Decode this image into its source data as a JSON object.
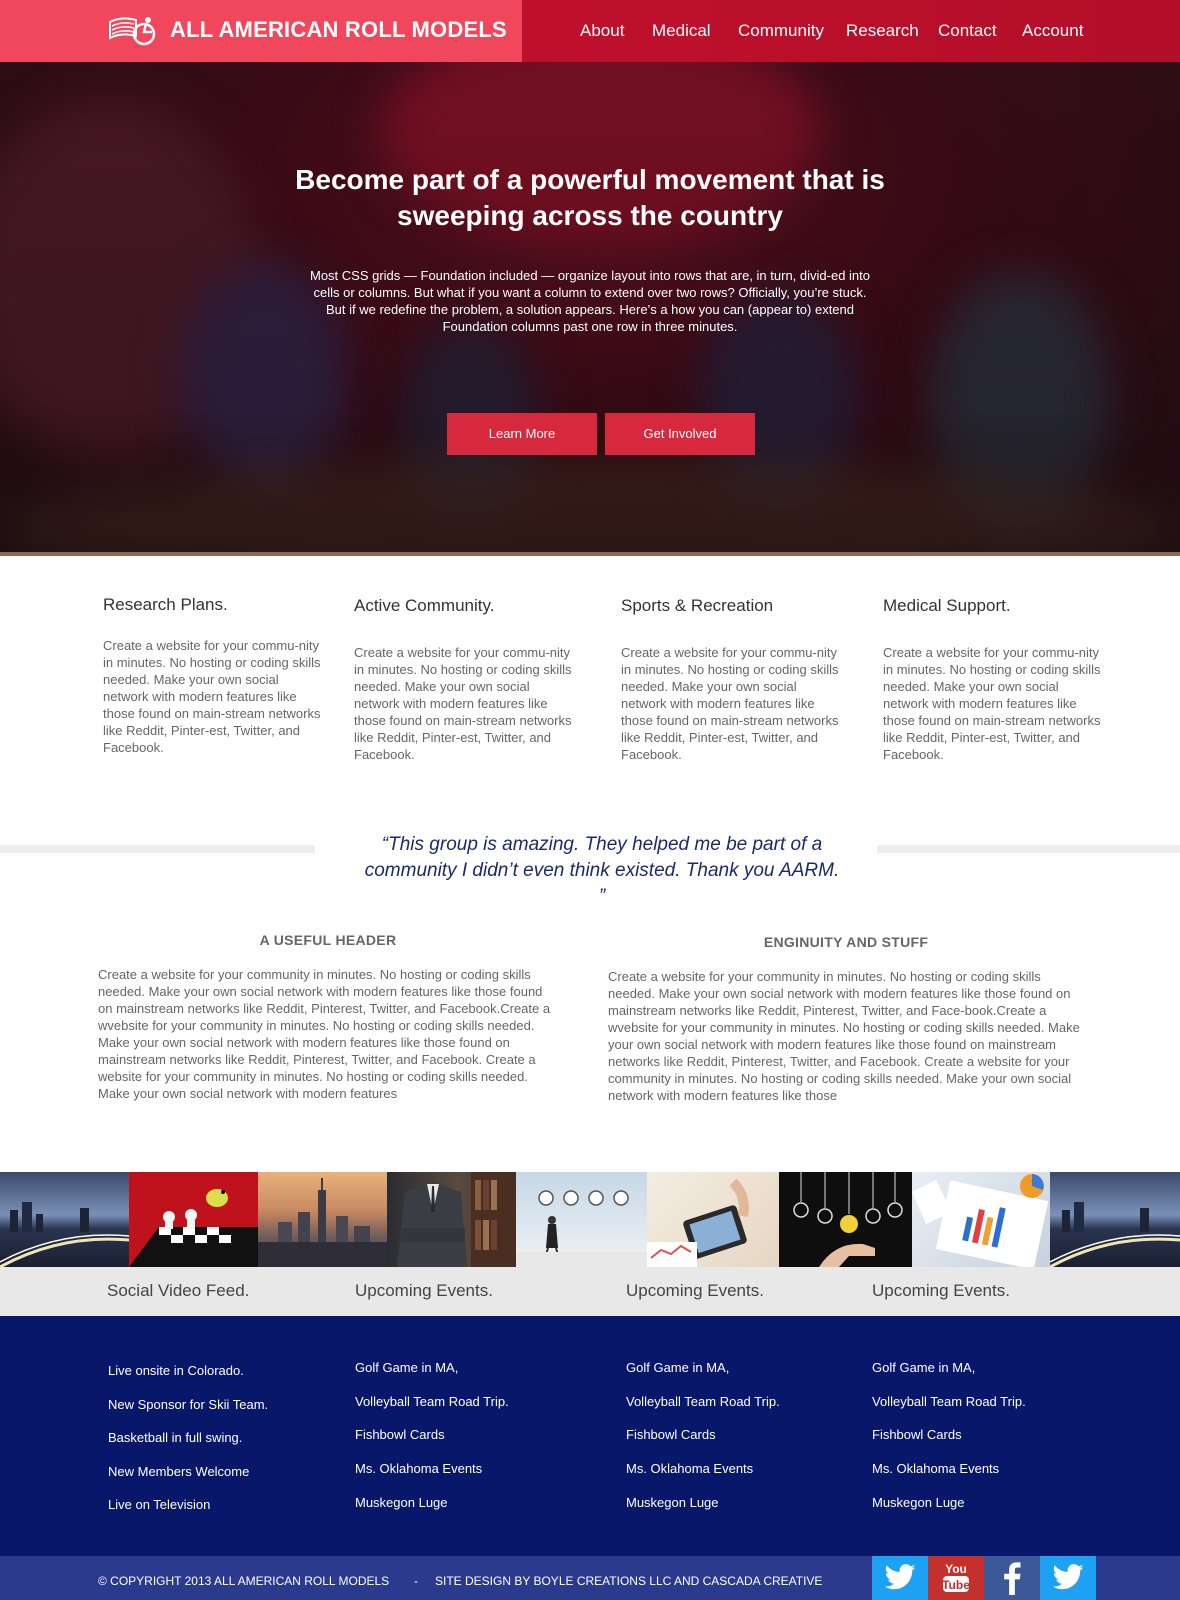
{
  "header": {
    "brand": "ALL AMERICAN ROLL MODELS",
    "nav": [
      "About",
      "Medical",
      "Community",
      "Research",
      "Contact",
      "Account"
    ]
  },
  "hero": {
    "title": "Become part of a powerful movement that is sweeping across the country",
    "text": "Most CSS grids — Foundation included — organize layout into rows that are, in turn, divid-ed into cells or columns. But what if you want a column to extend over two rows? Officially, you’re stuck. But if we redefine the problem, a solution appears. Here’s a how you can (appear to) extend Foundation columns past one row in three minutes.",
    "buttons": [
      "Learn More",
      "Get Involved"
    ]
  },
  "features": [
    {
      "title": "Research Plans.",
      "text": "Create a website for your commu-nity in minutes. No hosting or coding skills needed. Make your own social network with modern features like those found on main-stream networks like Reddit, Pinter-est, Twitter, and Facebook."
    },
    {
      "title": "Active Community.",
      "text": "Create a website for your commu-nity in minutes. No hosting or coding skills needed. Make your own social network with modern features like those found on main-stream networks like Reddit, Pinter-est, Twitter, and Facebook."
    },
    {
      "title": "Sports & Recreation",
      "text": "Create a website for your commu-nity in minutes. No hosting or coding skills needed. Make your own social network with modern features like those found on main-stream networks like Reddit, Pinter-est, Twitter, and Facebook."
    },
    {
      "title": "Medical Support.",
      "text": "Create a website for your commu-nity in minutes. No hosting or coding skills needed. Make your own social network with modern features like those found on main-stream networks like Reddit, Pinter-est, Twitter, and Facebook."
    }
  ],
  "testimonial": "“This group is amazing. They helped me be part of a community I didn’t even think existed. Thank you AARM. ”",
  "columns": [
    {
      "header": "A USEFUL HEADER",
      "text": "Create a website for your community in minutes. No hosting or coding skills needed. Make your own social network with modern features like those found on mainstream networks like Reddit, Pinterest, Twitter, and Facebook.Create a wvebsite for your community in minutes. No hosting or coding skills needed. Make your own social network with modern features like those found on mainstream networks like Reddit, Pinterest, Twitter, and Facebook. Create a website for your community in minutes. No hosting or coding skills needed. Make your own social network with modern features"
    },
    {
      "header": "ENGINUITY AND STUFF",
      "text": "Create a website for your community in minutes. No hosting or coding skills needed. Make your own social network with modern features like those found on mainstream networks like Reddit, Pinterest, Twitter, and Face-book.Create a wvebsite for your community in minutes. No hosting or coding skills needed. Make your own social network with modern features like those found on mainstream networks like Reddit, Pinterest, Twitter, and Facebook. Create a website for your community in minutes. No hosting or coding skills needed. Make your own social network with modern features like those"
    }
  ],
  "gallery": [
    "city-night-bridge",
    "chess-bird",
    "city-skyline-sunset",
    "businessman-books",
    "woman-clocks",
    "tablet-charts",
    "lightbulbs-hand",
    "financial-charts",
    "city-night-bridge"
  ],
  "footer_columns": [
    {
      "title": "Social Video Feed.",
      "items": [
        "Live onsite in Colorado.",
        "New Sponsor for Skii Team.",
        "Basketball in full swing.",
        "New Members Welcome",
        "Live on Television"
      ]
    },
    {
      "title": "Upcoming Events.",
      "items": [
        "Golf Game in MA,",
        "Volleyball Team Road Trip.",
        "Fishbowl Cards",
        "Ms. Oklahoma Events",
        "Muskegon Luge"
      ]
    },
    {
      "title": "Upcoming Events.",
      "items": [
        "Golf Game in MA,",
        "Volleyball Team Road Trip.",
        "Fishbowl Cards",
        "Ms. Oklahoma Events",
        "Muskegon Luge"
      ]
    },
    {
      "title": "Upcoming Events.",
      "items": [
        "Golf Game in MA,",
        "Volleyball Team Road Trip.",
        "Fishbowl Cards",
        "Ms. Oklahoma Events",
        "Muskegon Luge"
      ]
    }
  ],
  "copyright": {
    "left": "© COPYRIGHT 2013 ALL AMERICAN ROLL MODELS",
    "separator": "-",
    "right": "SITE DESIGN BY BOYLE CREATIONS LLC AND CASCADA CREATIVE"
  },
  "social": [
    {
      "icon": "twitter-icon",
      "color": "#1da1f2"
    },
    {
      "icon": "youtube-icon",
      "color": "#c4302b"
    },
    {
      "icon": "facebook-icon",
      "color": "#3b5998"
    },
    {
      "icon": "twitter-icon",
      "color": "#1da1f2"
    }
  ],
  "colors": {
    "brand_red": "#c8102e",
    "brand_pink": "#f0475c",
    "button_red": "#d6293d",
    "navy": "#08176a",
    "quote_blue": "#1b2a6b"
  }
}
